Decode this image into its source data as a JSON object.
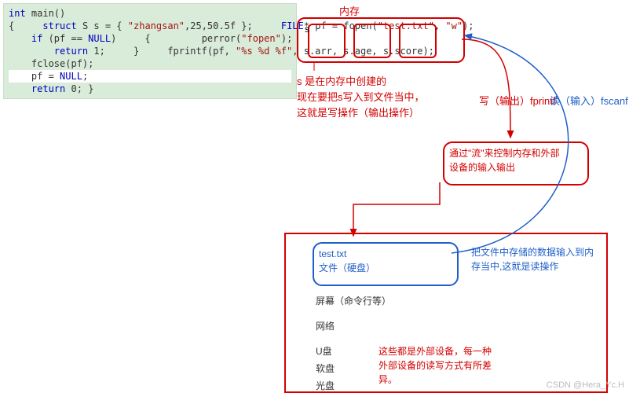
{
  "memory_title": "内存",
  "s_var": "s",
  "annotation1_line1": "s 是在内存中创建的",
  "annotation1_line2": "现在要把s写入到文件当中，",
  "annotation1_line3": "这就是写操作（输出操作）",
  "fprintf_label": "写（输出）fprintf",
  "fscanf_label": "读（输入）fscanf",
  "flow_line1": "通过\"流\"来控制内存和外部",
  "flow_line2": "设备的输入输出",
  "file_line1": "test.txt",
  "file_line2": "文件（硬盘）",
  "read_ann_line1": "把文件中存储的数据输入到内",
  "read_ann_line2": "存当中,这就是读操作",
  "ext_screen": "屏幕（命令行等）",
  "ext_net": "网络",
  "ext_udisk": "U盘",
  "ext_floppy": "软盘",
  "ext_cd": "光盘",
  "ext_note_line1": "这些都是外部设备，每一种",
  "ext_note_line2": "外部设备的读写方式有所差",
  "ext_note_line3": "异。",
  "watermark": "CSDN @Hera_Yc.H",
  "code": {
    "l0": "int main()",
    "l1": "{",
    "l2": "    struct S s = { \"zhangsan\",25,50.5f };",
    "l3": "",
    "l4": "    FILE* pf = fopen(\"test.txt\", \"w\");",
    "l5": "    if (pf == NULL)",
    "l6": "    {",
    "l7": "        perror(\"fopen\");",
    "l8": "        return 1;",
    "l9": "    }",
    "l10": "    fprintf(pf, \"%s %d %f\", s.arr, s.age, s.score);",
    "l11": "",
    "l12": "    fclose(pf);",
    "l13": "    pf = NULL;",
    "l14": "    return 0;",
    "l15": "}"
  }
}
